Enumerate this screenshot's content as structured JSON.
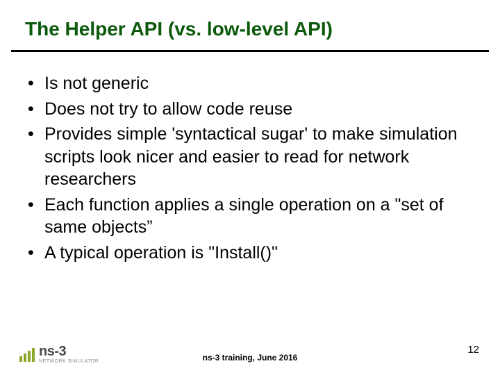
{
  "title": "The Helper API (vs. low-level API)",
  "bullets": [
    "Is not generic",
    "Does not try to allow code reuse",
    "Provides simple 'syntactical sugar' to make simulation scripts look nicer and easier to read for network researchers",
    "Each function applies a single operation on a \"set of same objects”",
    "A typical operation is \"Install()\""
  ],
  "footer": "ns-3 training, June 2016",
  "page_number": "12",
  "logo": {
    "main": "ns-3",
    "sub": "NETWORK SIMULATOR"
  }
}
